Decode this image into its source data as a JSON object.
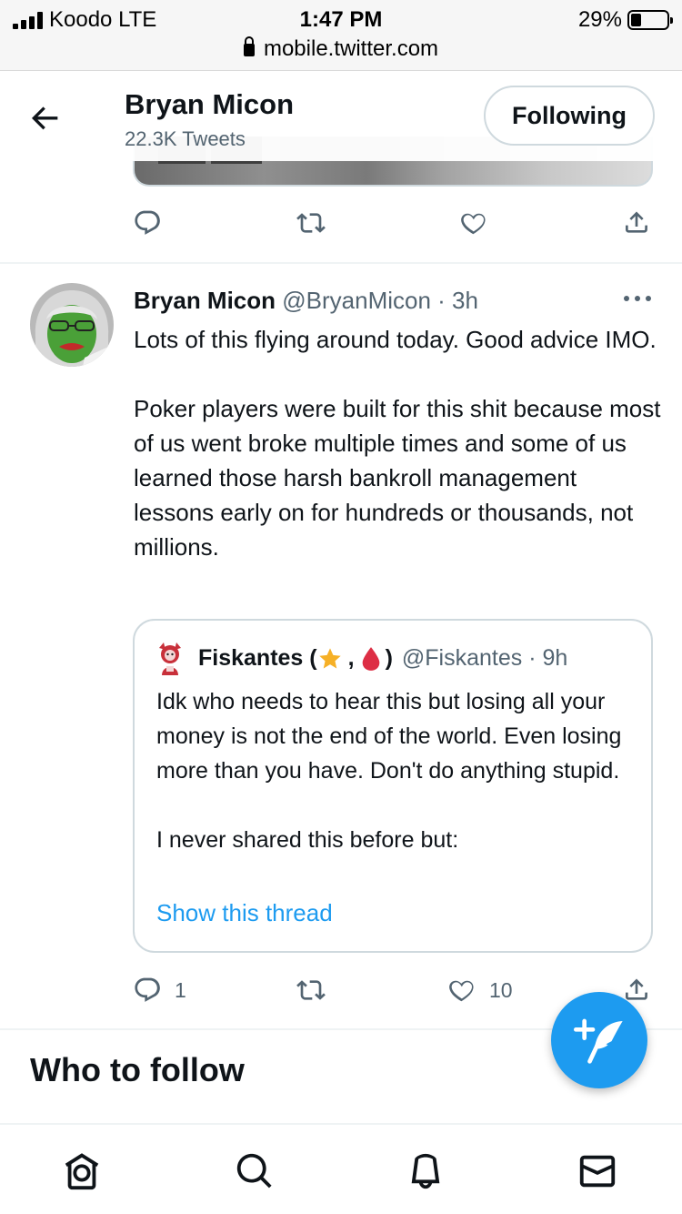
{
  "status_bar": {
    "carrier": "Koodo  LTE",
    "time": "1:47 PM",
    "battery_percent": "29%",
    "battery_level": 0.29,
    "url": "mobile.twitter.com"
  },
  "header": {
    "name": "Bryan Micon",
    "tweet_count": "22.3K Tweets",
    "follow_label": "Following"
  },
  "tweet": {
    "name": "Bryan Micon",
    "meta": "@BryanMicon · 3h",
    "text": "Lots of this flying around today. Good advice IMO.\n\nPoker players were built for this shit because most of us went broke multiple times and some of us learned those harsh bankroll management lessons early on for hundreds or thousands, not millions.",
    "quote": {
      "name": "Fiskantes (",
      "name_sep": ",",
      "name_end": ")",
      "meta": "@Fiskantes · 9h",
      "text": "Idk who needs to hear this but losing all your money is not the end of the world. Even losing more than you have. Don't do anything stupid.\n\nI never shared this before but:",
      "link": "Show this thread"
    },
    "reply_count": "1",
    "like_count": "10"
  },
  "section": {
    "who_to_follow": "Who to follow"
  },
  "icons": {
    "accent": "#1d9bf0",
    "secondary": "#536471"
  }
}
